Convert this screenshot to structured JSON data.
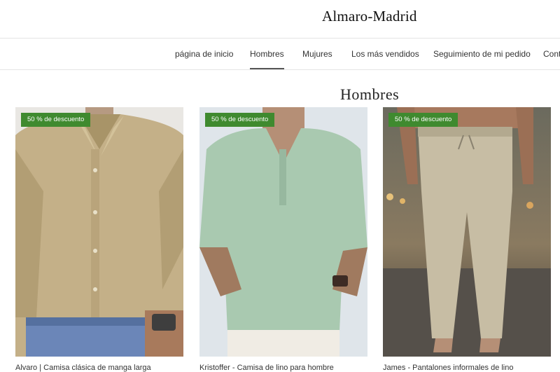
{
  "brand": {
    "name": "Almaro-Madrid"
  },
  "nav": {
    "items": [
      {
        "label": "página de inicio"
      },
      {
        "label": "Hombres",
        "active": true
      },
      {
        "label": "Mujures"
      },
      {
        "label": "Los más vendidos"
      },
      {
        "label": "Seguimiento de mi pedido"
      },
      {
        "label": "Cont"
      }
    ]
  },
  "page": {
    "title": "Hombres"
  },
  "products": [
    {
      "badge": "50 % de descuento",
      "title": "Alvaro | Camisa clásica de manga larga",
      "image": "khaki-button-down-shirt"
    },
    {
      "badge": "50 % de descuento",
      "title": "Kristoffer - Camisa de lino para hombre",
      "image": "mint-linen-henley-shirt"
    },
    {
      "badge": "50 % de descuento",
      "title": "James - Pantalones informales de lino",
      "image": "beige-linen-drawstring-pants"
    }
  ],
  "colors": {
    "badge": "#3f8a2f",
    "khaki": "#c4b088",
    "mint": "#a9c9b0",
    "beige": "#c7bda4"
  }
}
